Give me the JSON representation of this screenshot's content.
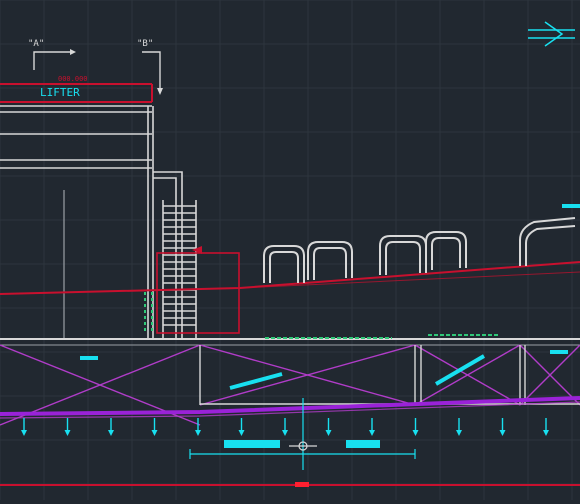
{
  "drawing": {
    "background": "#212830",
    "grid_color": "#2d353e",
    "section_markers": [
      "\"A\"",
      "\"B\""
    ],
    "label_lifter": "LIFTER",
    "label_level": "000.000"
  },
  "colors": {
    "white": "#d8d8d8",
    "gray": "#9aa0a6",
    "red": "#c8102e",
    "cyan": "#18e0f0",
    "magenta": "#b03cc8",
    "purple": "#9a22d8",
    "green": "#30c878"
  },
  "icons": {
    "north_arrow": "arrow-right-icon",
    "support_symbol": "support-arrow-icon"
  }
}
